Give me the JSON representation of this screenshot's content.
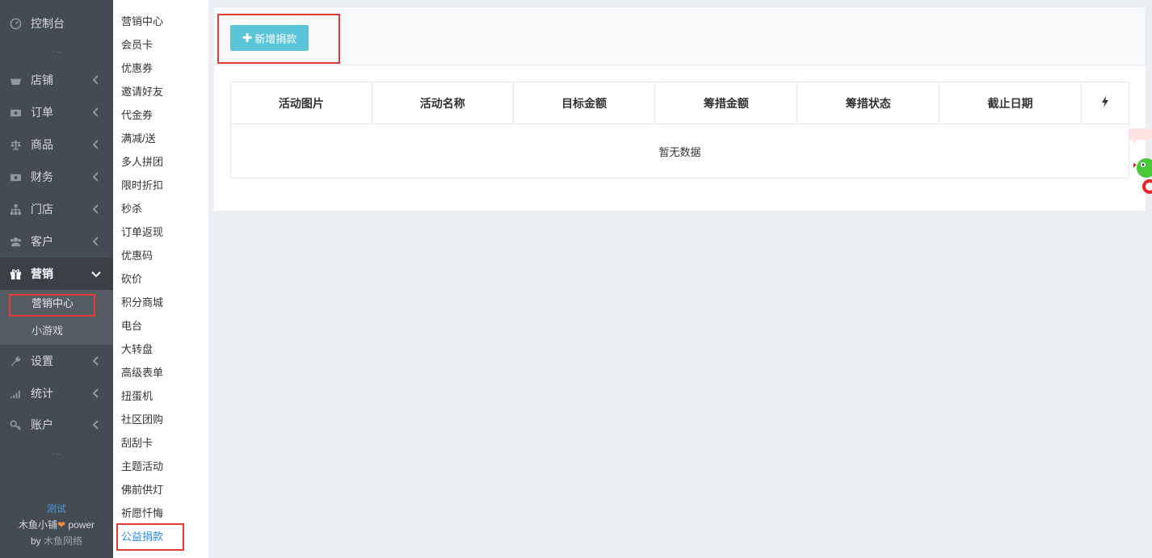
{
  "sidebar": {
    "dashboard": "控制台",
    "items": [
      {
        "label": "店铺",
        "icon": "basket-icon"
      },
      {
        "label": "订单",
        "icon": "money-icon"
      },
      {
        "label": "商品",
        "icon": "scale-icon"
      },
      {
        "label": "财务",
        "icon": "cash-icon"
      },
      {
        "label": "门店",
        "icon": "sitemap-icon"
      },
      {
        "label": "客户",
        "icon": "users-icon"
      },
      {
        "label": "营销",
        "icon": "gift-icon"
      },
      {
        "label": "设置",
        "icon": "wrench-icon"
      },
      {
        "label": "统计",
        "icon": "signal-icon"
      },
      {
        "label": "账户",
        "icon": "key-icon"
      }
    ],
    "sub_items": [
      "营销中心",
      "小游戏"
    ],
    "dots": "...",
    "footer": {
      "test": "测试",
      "brand": "木鱼小铺",
      "power": " power",
      "by": "by ",
      "company": "木鱼网络"
    }
  },
  "submenu": {
    "items": [
      "营销中心",
      "会员卡",
      "优惠券",
      "邀请好友",
      "代金券",
      "满减/送",
      "多人拼团",
      "限时折扣",
      "秒杀",
      "订单返现",
      "优惠码",
      "砍价",
      "积分商城",
      "电台",
      "大转盘",
      "高级表单",
      "扭蛋机",
      "社区团购",
      "刮刮卡",
      "主题活动",
      "佛前供灯",
      "祈愿忏悔",
      "公益捐款"
    ]
  },
  "toolbar": {
    "add_label": "新增捐款"
  },
  "table": {
    "columns": [
      "活动图片",
      "活动名称",
      "目标金额",
      "筹措金额",
      "筹措状态",
      "截止日期"
    ],
    "empty": "暂无数据"
  },
  "colors": {
    "sidebar_bg": "#444b52",
    "accent_button": "#5bc5d8",
    "highlight": "#e53935",
    "link": "#2e8ae6"
  }
}
